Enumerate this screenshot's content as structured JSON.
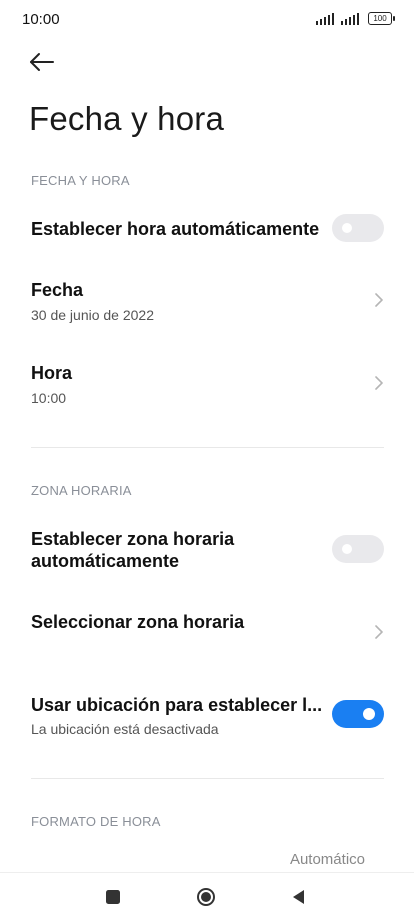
{
  "status": {
    "time": "10:00",
    "battery": "100"
  },
  "header": {
    "back_icon": "arrow-left-icon",
    "title": "Fecha y hora"
  },
  "sections": {
    "date_time": {
      "header": "FECHA Y HORA",
      "auto_time_label": "Establecer hora automáticamente",
      "auto_time_enabled": false,
      "date_label": "Fecha",
      "date_value": "30 de junio de 2022",
      "time_label": "Hora",
      "time_value": "10:00"
    },
    "time_zone": {
      "header": "ZONA HORARIA",
      "auto_zone_label_line1": "Establecer zona horaria",
      "auto_zone_label_line2": "automáticamente",
      "auto_zone_enabled": false,
      "select_zone_label": "Seleccionar zona horaria",
      "use_location_label": "Usar ubicación para establecer l...",
      "use_location_sub": "La ubicación está desactivada",
      "use_location_enabled": true
    },
    "time_format": {
      "header": "FORMATO DE HORA",
      "value": "Automático"
    }
  },
  "colors": {
    "accent": "#1a7ff2",
    "toggle_off": "#e9e9ec",
    "section_header": "#8a8f98"
  },
  "nav": {
    "recent_icon": "square-icon",
    "home_icon": "circle-icon",
    "back_icon": "triangle-back-icon"
  }
}
